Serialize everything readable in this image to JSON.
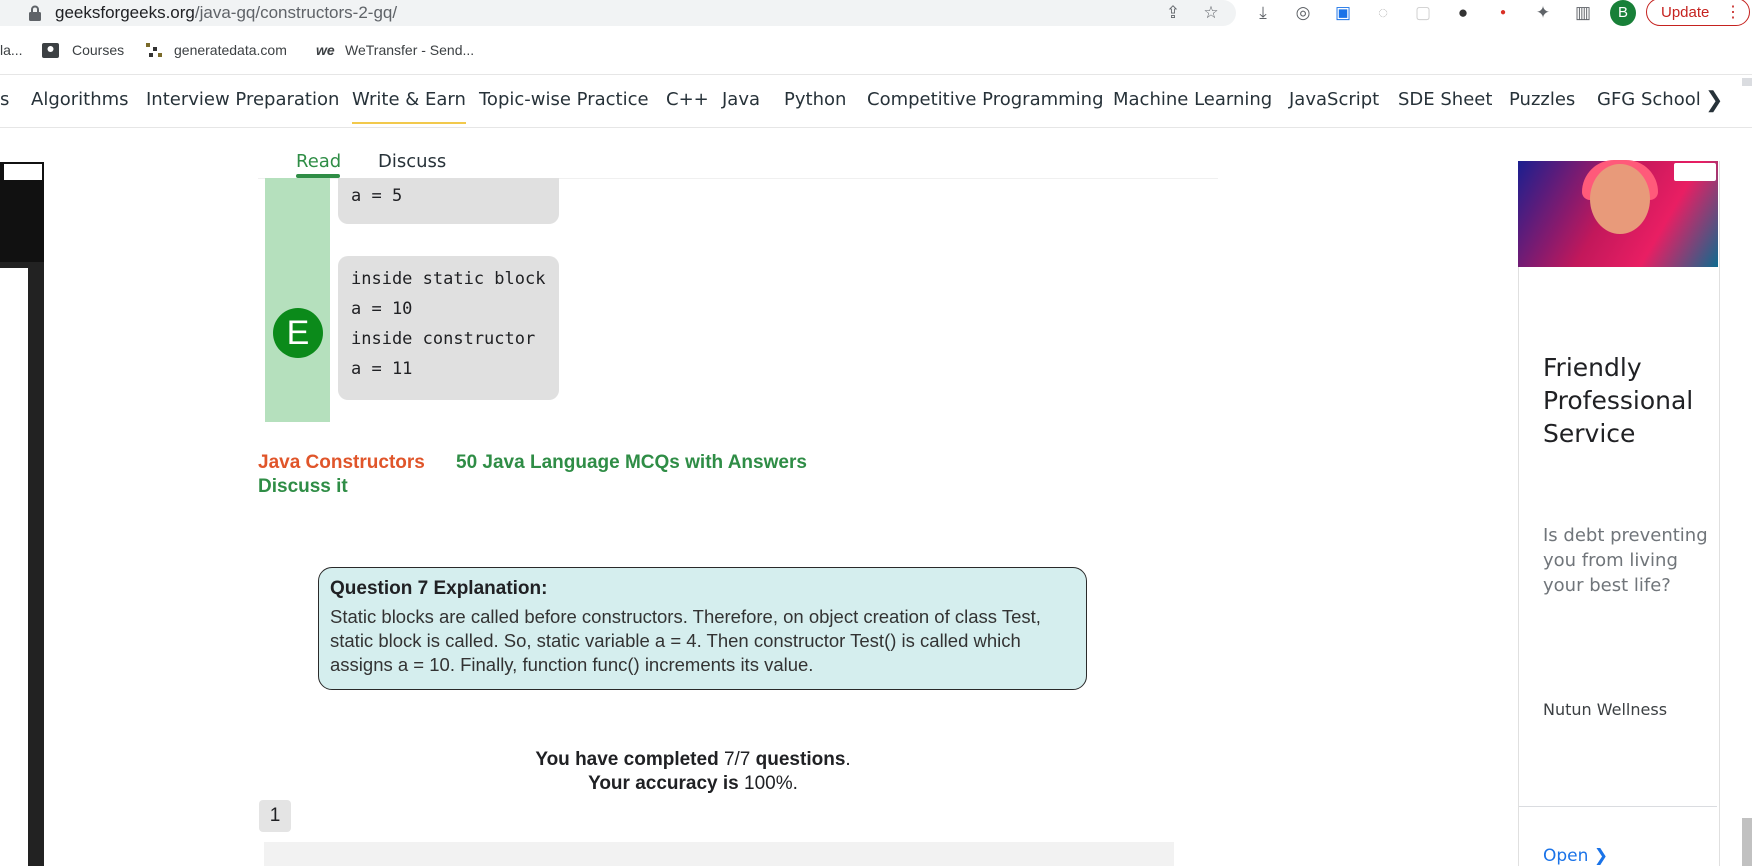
{
  "browser": {
    "url_host": "geeksforgeeks.org",
    "url_path": "/java-gq/constructors-2-gq/",
    "profile_initial": "B",
    "update_label": "Update",
    "menu_glyph": "⋮"
  },
  "bookmarks": [
    {
      "label": "la..."
    },
    {
      "label": "Courses"
    },
    {
      "label": "generatedata.com"
    },
    {
      "label": "WeTransfer - Send..."
    }
  ],
  "nav": {
    "items": [
      "s",
      "Algorithms",
      "Interview Preparation",
      "Write & Earn",
      "Topic-wise Practice",
      "C++",
      "Java",
      "Python",
      "Competitive Programming",
      "Machine Learning",
      "JavaScript",
      "SDE Sheet",
      "Puzzles",
      "GFG School"
    ],
    "arrow": "❯"
  },
  "tabs": {
    "read": "Read",
    "discuss": "Discuss"
  },
  "options": {
    "d_lines": [
      "a = 5"
    ],
    "e_badge": "E",
    "e_lines": [
      "inside static block",
      "a = 10",
      "inside constructor",
      "a = 11"
    ]
  },
  "links": {
    "java_constructors": "Java Constructors",
    "mcqs": "50 Java Language MCQs with Answers",
    "discuss": "Discuss it"
  },
  "explanation": {
    "title": "Question 7 Explanation:",
    "body": "Static blocks are called before constructors. Therefore, on object creation of class Test, static block is called. So, static variable a = 4. Then constructor Test() is called which assigns a = 10. Finally, function func() increments its value."
  },
  "result": {
    "completed_prefix": "You have completed",
    "completed_value": "7/7",
    "completed_suffix": "questions",
    "accuracy_prefix": "Your accuracy is",
    "accuracy_value": "100%"
  },
  "pagination": {
    "current": "1"
  },
  "ad": {
    "headline": "Friendly Professional Service",
    "subtext": "Is debt preventing you from living your best life?",
    "brand": "Nutun Wellness",
    "cta": "Open",
    "cta_arrow": "❯"
  },
  "colors": {
    "gfg_green": "#2f8d46",
    "link_orange": "#e0552a",
    "explain_bg": "#d5eeee",
    "option_strip": "#b5e0bd"
  }
}
